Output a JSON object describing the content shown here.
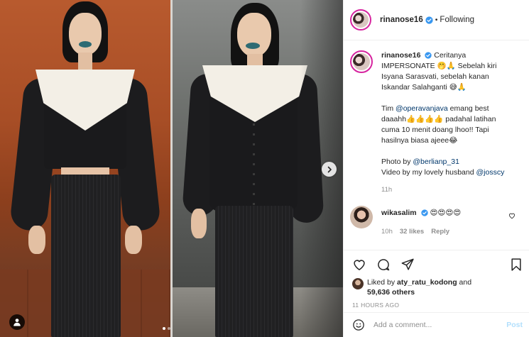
{
  "post": {
    "username": "rinanose16",
    "follow_state": "Following",
    "separator": "•"
  },
  "caption": {
    "username": "rinanose16",
    "lines": [
      "Ceritanya",
      "IMPERSONATE 🤭🙏 Sebelah kiri",
      "Isyana Sarasvati, sebelah kanan",
      "Iskandar Salahganti 😅🙏"
    ],
    "para2_prefix": "Tim ",
    "para2_mention": "@operavanjava",
    "para2_suffix": " emang best",
    "para2_lines": [
      "daaahh👍👍👍👍 padahal latihan",
      "cuma 10 menit doang lhoo!! Tapi",
      "hasilnya biasa ajeee😂"
    ],
    "photo_by_prefix": "Photo by ",
    "photo_by_mention": "@berlianp_31",
    "video_by_prefix": "Video by my lovely husband ",
    "video_by_mention": "@josscy",
    "time": "11h"
  },
  "comment": {
    "username": "wikasalim",
    "text": " 😍😍😍😍",
    "time": "10h",
    "likes": "32 likes",
    "reply": "Reply"
  },
  "likes": {
    "prefix": "Liked by ",
    "user": "aty_ratu_kodong",
    "and": " and",
    "count": "59,636 others"
  },
  "timestamp": "11 HOURS AGO",
  "add_comment": {
    "placeholder": "Add a comment...",
    "post_label": "Post"
  },
  "colors": {
    "verified": "#3897f0",
    "link": "#00376b",
    "muted": "#8e8e8e",
    "post_disabled": "#b2dffc"
  },
  "icons": [
    "verified-icon",
    "heart-icon",
    "comment-icon",
    "share-icon",
    "save-icon",
    "emoji-icon",
    "user-tag-icon",
    "chevron-right-icon"
  ]
}
